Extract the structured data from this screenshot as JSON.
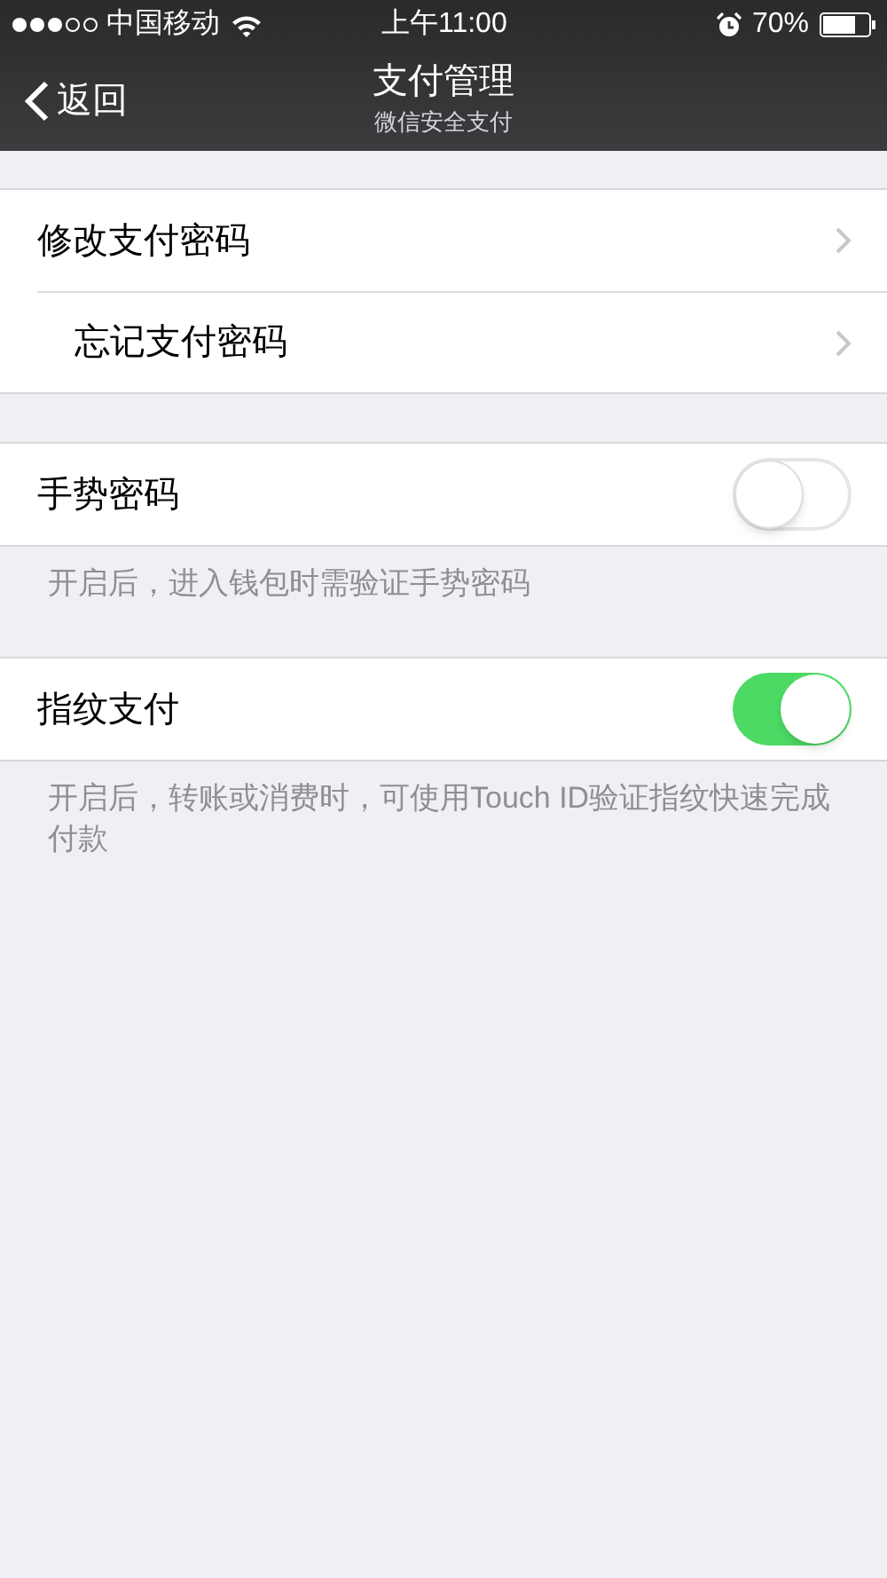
{
  "status_bar": {
    "carrier": "中国移动",
    "time": "上午11:00",
    "battery": "70%"
  },
  "nav": {
    "back": "返回",
    "title": "支付管理",
    "subtitle": "微信安全支付"
  },
  "sections": [
    {
      "rows": [
        {
          "kind": "link",
          "label": "修改支付密码"
        },
        {
          "kind": "link",
          "label": "忘记支付密码"
        }
      ]
    },
    {
      "rows": [
        {
          "kind": "toggle",
          "label": "手势密码",
          "on": false
        }
      ],
      "footer": "开启后，进入钱包时需验证手势密码"
    },
    {
      "rows": [
        {
          "kind": "toggle",
          "label": "指纹支付",
          "on": true
        }
      ],
      "footer": "开启后，转账或消费时，可使用Touch ID验证指纹快速完成付款"
    }
  ]
}
